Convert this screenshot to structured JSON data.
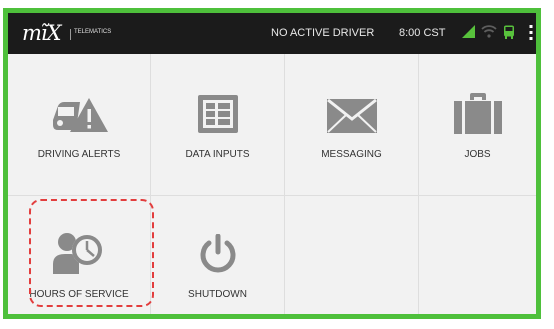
{
  "statusbar": {
    "logo_mark": "mĩX",
    "logo_sub": "TELEMATICS",
    "driver_status": "NO ACTIVE DRIVER",
    "time": "8:00 CST",
    "icons": [
      "signal-icon",
      "wifi-icon",
      "bus-icon",
      "overflow-menu-icon"
    ],
    "colors": {
      "signal": "#58c23c",
      "wifi": "#666666",
      "bus": "#58c23c"
    }
  },
  "tiles": [
    {
      "label": "DRIVING ALERTS",
      "icon": "car-alert-icon"
    },
    {
      "label": "DATA INPUTS",
      "icon": "data-grid-icon"
    },
    {
      "label": "MESSAGING",
      "icon": "envelope-icon"
    },
    {
      "label": "JOBS",
      "icon": "briefcase-icon"
    },
    {
      "label": "HOURS OF SERVICE",
      "icon": "driver-clock-icon"
    },
    {
      "label": "SHUTDOWN",
      "icon": "power-icon"
    }
  ],
  "colors": {
    "frame": "#4ec03b",
    "icon_gray": "#8a8a8a",
    "highlight": "#e23d3d"
  }
}
